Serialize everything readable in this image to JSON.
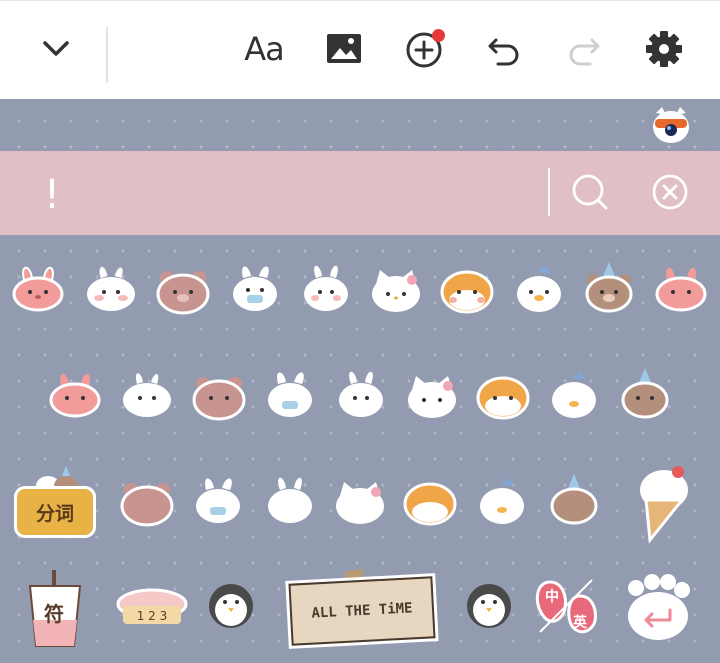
{
  "toolbar": {
    "collapse_icon": "chevron-down-icon",
    "font_label": "Aa",
    "image_icon": "image-icon",
    "add_icon": "add-circle-icon",
    "undo_icon": "undo-icon",
    "redo_icon": "redo-icon",
    "settings_icon": "gear-icon",
    "badge_color": "#e63a3a"
  },
  "searchbar": {
    "cursor": "!",
    "search_icon": "search-icon",
    "clear_icon": "close-circle-icon",
    "background": "#e0c0c5"
  },
  "keyboard": {
    "background": "#939bb1"
  },
  "stickers": {
    "fenci_label": "分词",
    "cup_label": "符",
    "strawberry_top": "中",
    "strawberry_bottom": "英",
    "note_text": "ALL THE TiME",
    "cake_numbers": "1 2 3"
  }
}
